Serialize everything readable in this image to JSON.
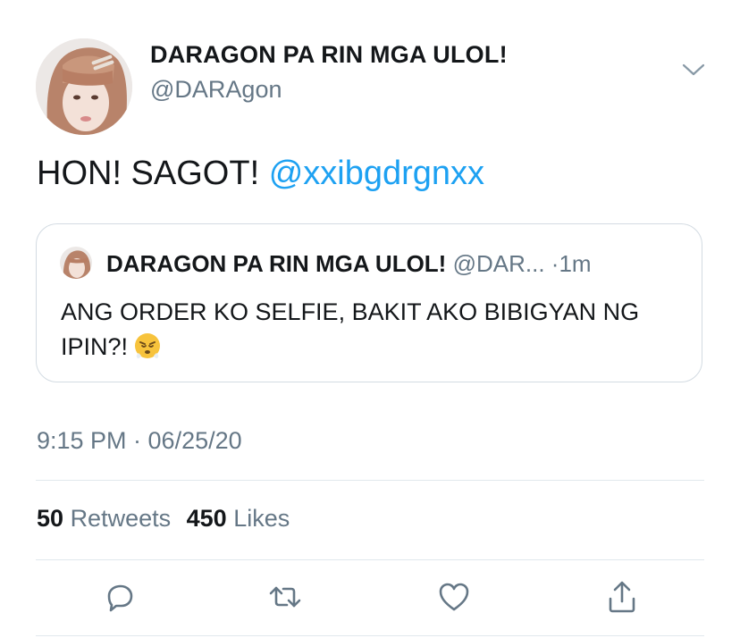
{
  "author": {
    "display_name": "DARAGON PA RIN MGA ULOL!",
    "handle": "@DARAgon"
  },
  "tweet": {
    "text": "HON! SAGOT! ",
    "mention": "@xxibgdrgnxx"
  },
  "quoted_tweet": {
    "display_name": "DARAGON PA RIN MGA ULOL!",
    "handle": "@DAR...",
    "separator_time": "·1m",
    "text": "ANG ORDER KO SELFIE, BAKIT AKO BIBIGYAN NG IPIN?!"
  },
  "timestamp": "9:15 PM · 06/25/20",
  "stats": {
    "retweets_count": "50",
    "retweets_label": "Retweets",
    "likes_count": "450",
    "likes_label": "Likes"
  },
  "colors": {
    "accent": "#1da1f2",
    "secondary_text": "#657786",
    "border": "#e1e8ed"
  },
  "icons": [
    "chevron-down-icon",
    "reply-icon",
    "retweet-icon",
    "like-icon",
    "share-icon",
    "steam-nose-emoji-icon"
  ]
}
